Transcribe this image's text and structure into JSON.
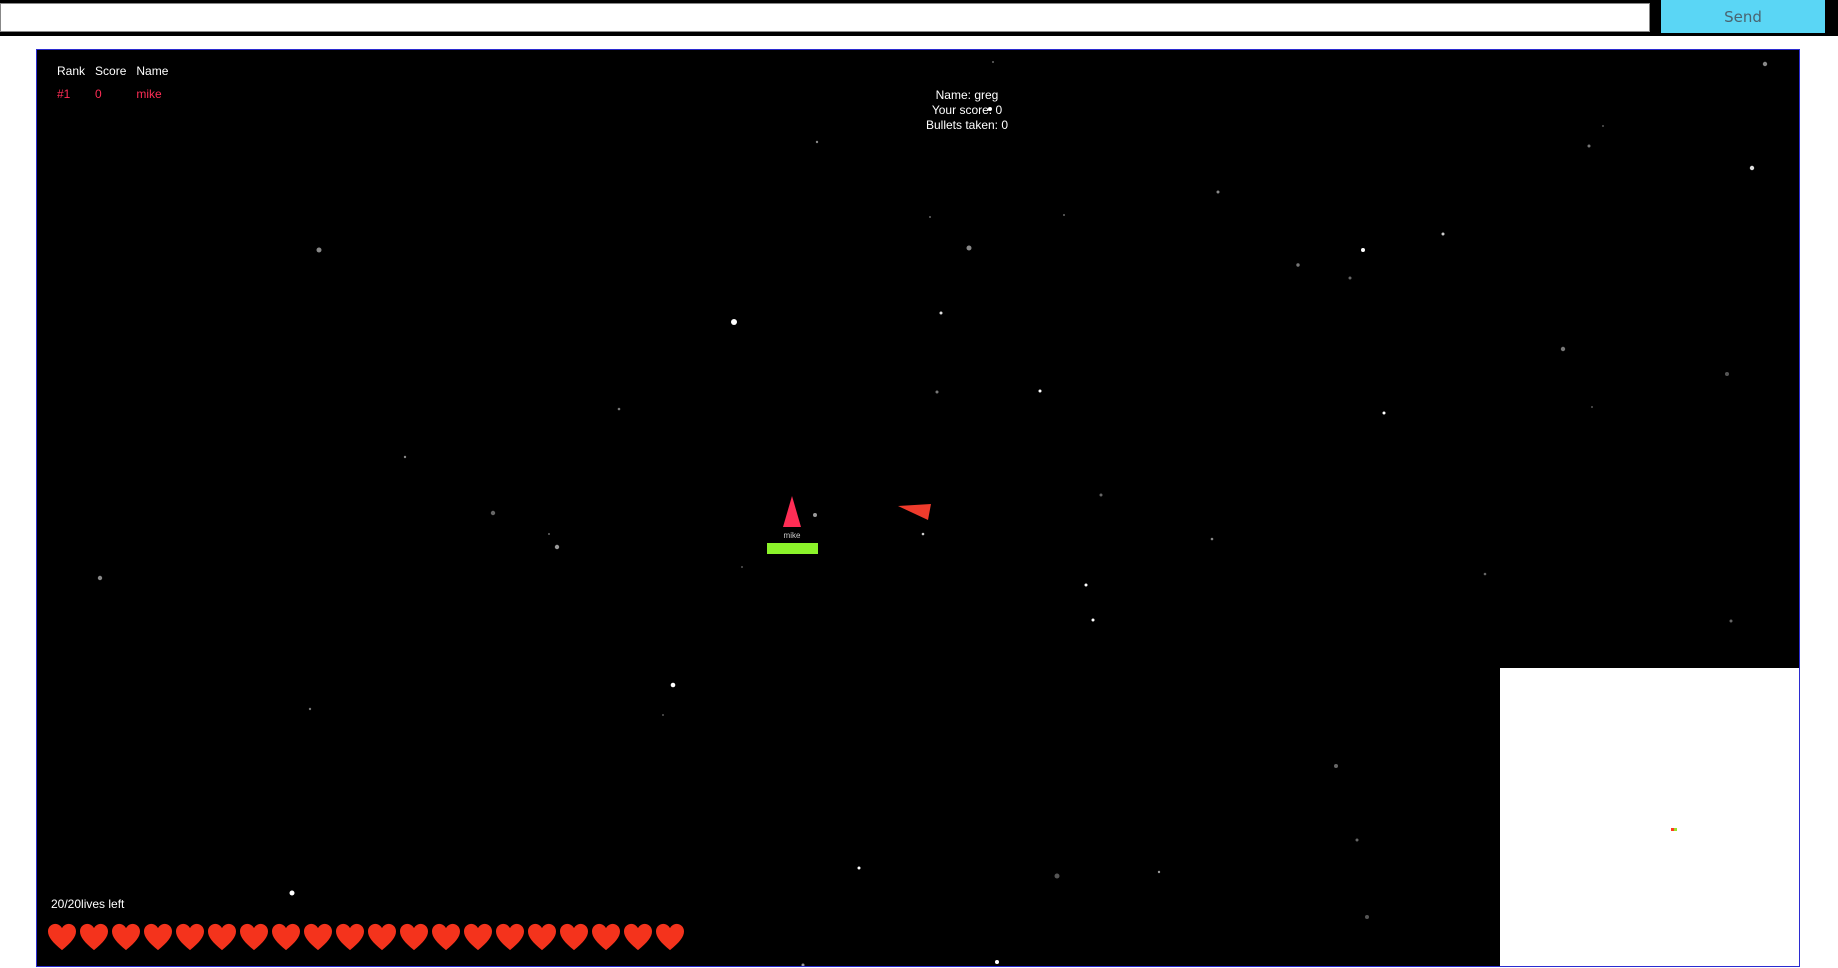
{
  "chat": {
    "input_value": "",
    "send_label": "Send"
  },
  "leaderboard": {
    "headers": [
      "Rank",
      "Score",
      "Name"
    ],
    "rows": [
      {
        "rank": "#1",
        "score": "0",
        "name": "mike"
      }
    ]
  },
  "stats": {
    "name_line": "Name: greg",
    "score_line": "Your score: 0",
    "bullets_line": "Bullets taken: 0"
  },
  "player": {
    "label": "mike",
    "health": 1.0,
    "color": "#ff2d55",
    "health_color": "#8bf22a"
  },
  "enemy": {
    "color": "#ef3b2c"
  },
  "lives": {
    "current": 20,
    "max": 20,
    "text": "20/20lives left",
    "heart_color": "#f4331c"
  },
  "colors": {
    "background": "#000000",
    "send_button": "#5ad6f5",
    "game_border": "#2b2bd0",
    "minimap": "#ffffff"
  }
}
